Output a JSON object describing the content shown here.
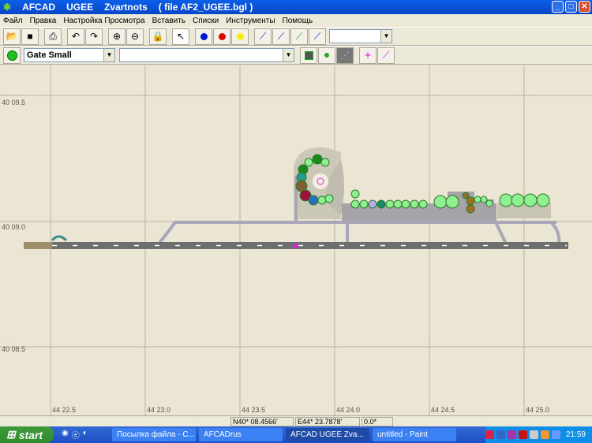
{
  "title": {
    "app": "AFCAD",
    "icao": "UGEE",
    "name": "Zvartnots",
    "file": "( file AF2_UGEE.bgl )"
  },
  "menu": [
    "Файл",
    "Правка",
    "Настройка Просмотра",
    "Вставить",
    "Списки",
    "Инструменты",
    "Помощь"
  ],
  "toolbar2": {
    "object_type": "Gate Small",
    "second_combo": ""
  },
  "map": {
    "lat_labels": [
      "40 09.5",
      "40 09.0",
      "40 08.5"
    ],
    "lon_labels": [
      "44 22.5",
      "44 23.0",
      "44 23.5",
      "44 24.0",
      "44 24.5",
      "44 25.0"
    ]
  },
  "status": {
    "lat": "N40* 08.4566'",
    "lon": "E44* 23.7878'",
    "heading": "0.0*"
  },
  "taskbar": {
    "start": "start",
    "tasks": [
      "Посылка файла - C...",
      "AFCADrus",
      "AFCAD   UGEE   Zva...",
      "untitled - Paint"
    ],
    "clock": "21:59"
  }
}
